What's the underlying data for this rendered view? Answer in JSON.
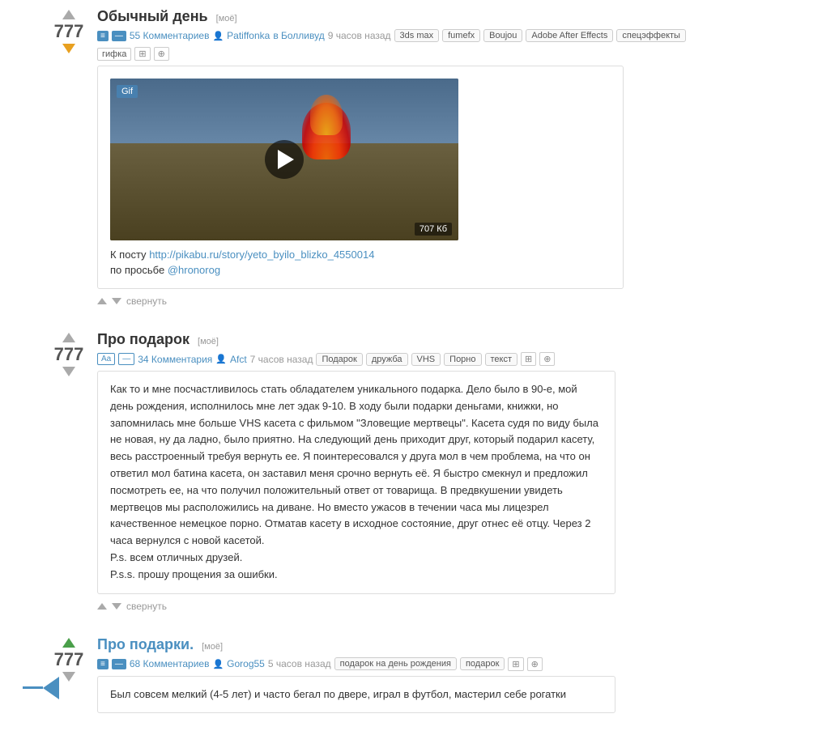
{
  "posts": [
    {
      "id": "post-1",
      "title": "Обычный день",
      "my_badge": "[моё]",
      "vote_count": "777",
      "vote_up_active": false,
      "vote_down_active": true,
      "icon_type": "image",
      "comments_count": "55 Комментариев",
      "author": "Patiffonka",
      "location": "в Болливуд",
      "time": "9 часов назад",
      "tags": [
        "3ds max",
        "fumefx",
        "Boujou",
        "Adobe After Effects",
        "спецэффекты"
      ],
      "second_row": [
        "гифка"
      ],
      "has_gif_row": true,
      "media_type": "video",
      "file_size": "707 Кб",
      "gif_label": "Gif",
      "link_text": "К посту",
      "link_url": "http://pikabu.ru/story/yeto_byilo_blizko_4550014",
      "by_request_prefix": "по просьбе",
      "by_request_user": "@hronorog",
      "has_arrow": false
    },
    {
      "id": "post-2",
      "title": "Про подарок",
      "my_badge": "[моё]",
      "vote_count": "777",
      "vote_up_active": false,
      "vote_down_active": false,
      "icon_type": "text",
      "comments_count": "34 Комментария",
      "author": "Afct",
      "location": "",
      "time": "7 часов назад",
      "tags": [
        "Подарок",
        "дружба",
        "VHS",
        "Порно",
        "текст"
      ],
      "has_gif_row": false,
      "media_type": "text",
      "body_text": "Как то и мне посчастливилось стать обладателем уникального подарка. Дело было в 90-е, мой день рождения, исполнилось мне лет эдак 9-10. В ходу были подарки деньгами, книжки, но запомнилась мне больше VHS касета с фильмом \"Зловещие мертвецы\". Касета судя по виду была не новая, ну да ладно, было приятно. На следующий день приходит друг, который подарил касету, весь расстроенный требуя вернуть ее. Я поинтересовался у друга мол в чем проблема, на что он ответил мол батина касета, он заставил меня срочно вернуть её. Я быстро смекнул и предложил посмотреть ее, на что получил положительный ответ от товарища. В предвкушении увидеть мертвецов мы расположились на диване. Но вместо ужасов в течении часа мы лицезрел качественное немецкое порно. Отматав касету в исходное состояние, друг отнес её отцу. Через 2 часа вернулся с новой касетой.\nP.s. всем отличных друзей.\nP.s.s. прошу прощения за ошибки.",
      "has_arrow": false
    },
    {
      "id": "post-3",
      "title": "Про подарки.",
      "my_badge": "[моё]",
      "vote_count": "777",
      "vote_up_active": true,
      "vote_down_active": false,
      "icon_type": "image",
      "comments_count": "68 Комментариев",
      "author": "Gorog55",
      "location": "",
      "time": "5 часов назад",
      "tags": [
        "подарок на день рождения",
        "подарок"
      ],
      "has_gif_row": false,
      "media_type": "text_preview",
      "body_preview": "Был совсем мелкий (4-5 лет) и часто бегал по двере, играл в футбол, мастерил себе рогатки",
      "has_arrow": true
    }
  ],
  "labels": {
    "collapse": "свернуть",
    "k_postu": "К посту",
    "po_prosbe": "по просьбе"
  }
}
